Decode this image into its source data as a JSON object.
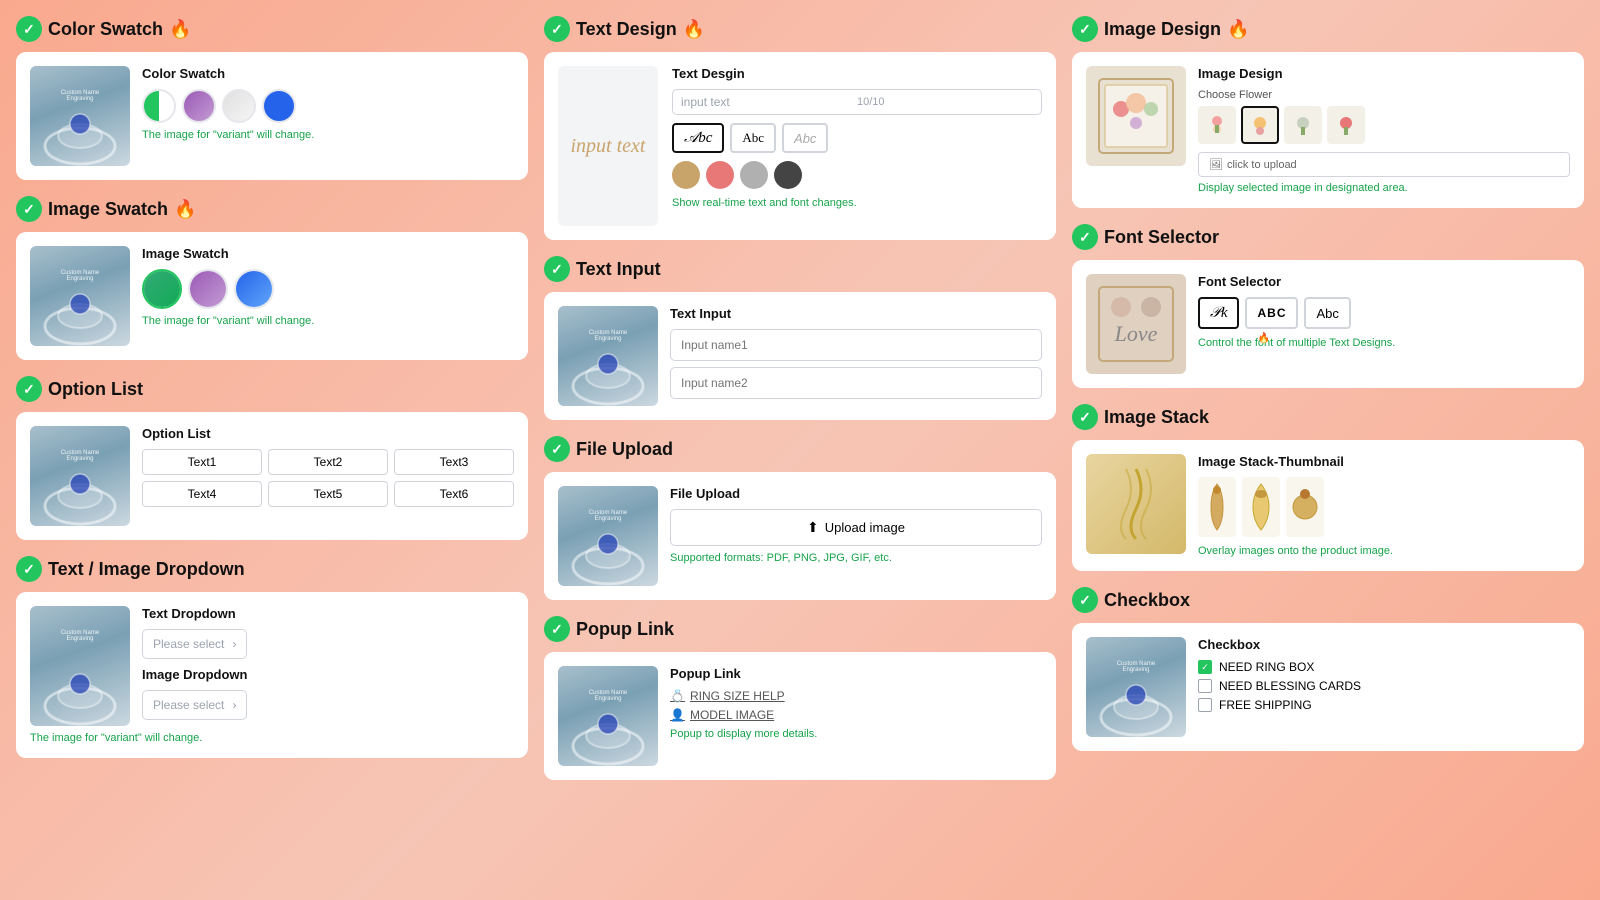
{
  "sections": {
    "color_swatch": {
      "title": "Color Swatch",
      "card_label": "Color Swatch",
      "note": "The image for \"variant\" will change.",
      "swatches": [
        "half-green-white",
        "purple",
        "white-outline",
        "blue"
      ]
    },
    "image_swatch": {
      "title": "Image Swatch",
      "card_label": "Image Swatch",
      "note": "The image for \"variant\" will change."
    },
    "option_list": {
      "title": "Option List",
      "card_label": "Option List",
      "options": [
        "Text1",
        "Text2",
        "Text3",
        "Text4",
        "Text5",
        "Text6"
      ]
    },
    "text_image_dropdown": {
      "title": "Text / Image Dropdown",
      "text_dropdown_label": "Text Dropdown",
      "image_dropdown_label": "Image Dropdown",
      "placeholder": "Please select",
      "note": "The image for \"variant\" will change."
    },
    "text_design": {
      "title": "Text Design",
      "card_label": "Text Desgin",
      "preview_text": "input text",
      "input_placeholder": "input text",
      "input_count": "10/10",
      "fonts": [
        "cursive-abc",
        "Abc",
        "Abc-light"
      ],
      "colors": [
        "#c9a46a",
        "#e87878",
        "#b0b0b0",
        "#444444"
      ],
      "note": "Show real-time text and font changes."
    },
    "text_input": {
      "title": "Text Input",
      "card_label": "Text  Input",
      "field1_placeholder": "Input name1",
      "field2_placeholder": "Input name2"
    },
    "file_upload": {
      "title": "File Upload",
      "card_label": "File Upload",
      "button_label": "Upload image",
      "note": "Supported formats: PDF, PNG, JPG, GIF, etc."
    },
    "popup_link": {
      "title": "Popup Link",
      "card_label": "Popup Link",
      "link1": "RING SIZE HELP",
      "link2": "MODEL IMAGE",
      "note": "Popup to display more details."
    },
    "image_design": {
      "title": "Image Design",
      "card_label": "Image Design",
      "sub_label": "Choose Flower",
      "upload_label": "click to upload",
      "note": "Display selected image in designated area."
    },
    "font_selector": {
      "title": "Font Selector",
      "card_label": "Font Selector",
      "fonts": [
        "cursive-pk",
        "ABC",
        "Abc"
      ],
      "note": "Control the font of multiple Text Designs."
    },
    "image_stack": {
      "title": "Image Stack",
      "card_label": "Image Stack-Thumbnail",
      "note": "Overlay images onto the product image."
    },
    "checkbox": {
      "title": "Checkbox",
      "card_label": "Checkbox",
      "items": [
        {
          "label": "NEED RING BOX",
          "checked": true
        },
        {
          "label": "NEED BLESSING CARDS",
          "checked": false
        },
        {
          "label": "FREE SHIPPING",
          "checked": false
        }
      ]
    }
  },
  "icons": {
    "check": "✓",
    "fire": "🔥",
    "upload": "⬆",
    "ring_link": "💍",
    "model_link": "👤",
    "chevron_down": "›"
  }
}
